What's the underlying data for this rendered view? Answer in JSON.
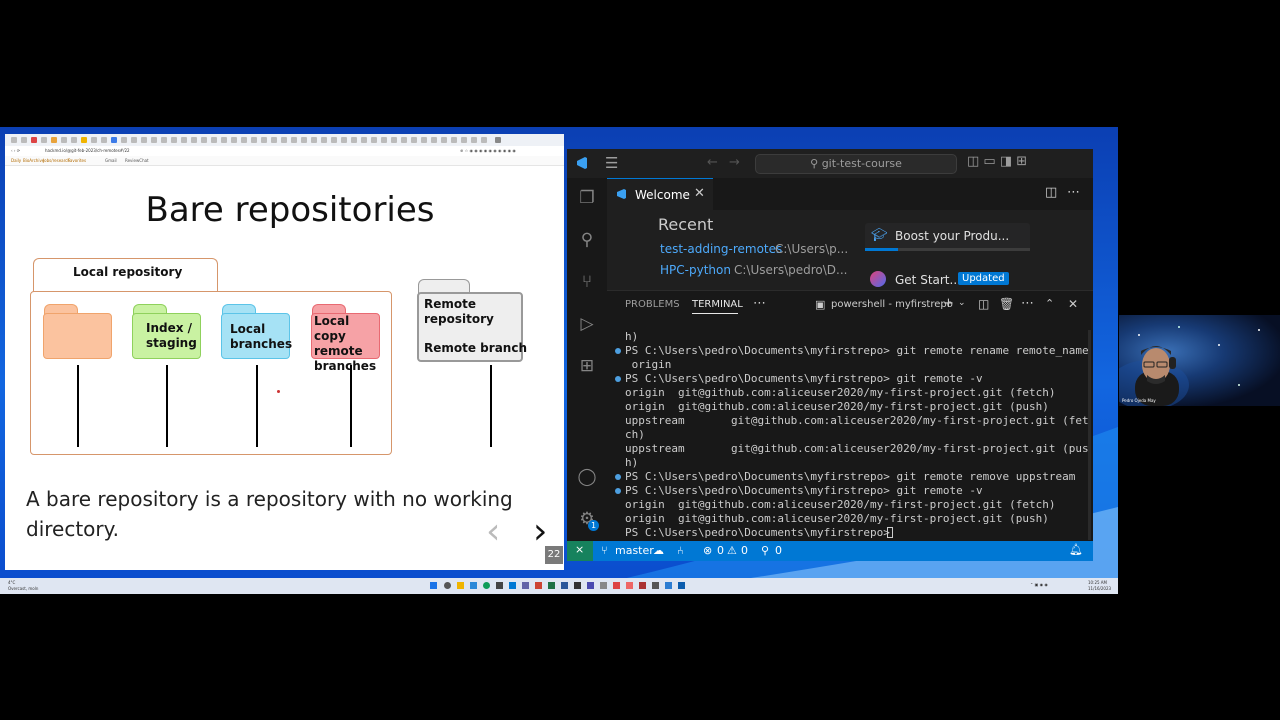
{
  "slide": {
    "title": "Bare repositories",
    "local_repo_label": "Local repository",
    "index_label": "Index / staging",
    "local_branches_label": "Local branches",
    "local_copy_label": "Local copy remote branches",
    "remote_repo_label": "Remote repository",
    "remote_branch_label": "Remote branch",
    "body_text": "A bare repository is a repository with no working directory.",
    "page_number": "22",
    "prev_arrow": "‹",
    "next_arrow": "›"
  },
  "browser": {
    "url_text": "hackmd.io/@git-feb-2023/ch-remotes#/22",
    "bookmarks": [
      "Daily",
      "BioArchive",
      "Jobs/research",
      "Favorites",
      "Gmail",
      "ReviewChat"
    ]
  },
  "vscode": {
    "search": "git-test-course",
    "tab_label": "Welcome",
    "recent_heading": "Recent",
    "recent": [
      {
        "name": "test-adding-remotes",
        "path": "C:\\Users\\p..."
      },
      {
        "name": "HPC-python",
        "path": "C:\\Users\\pedro\\D..."
      }
    ],
    "walkthroughs": [
      {
        "label": "Boost your Produ...",
        "badge": ""
      },
      {
        "label": "Get Start...",
        "badge": "Updated"
      }
    ],
    "panel_tabs": [
      "PROBLEMS",
      "TERMINAL"
    ],
    "terminal_name": "powershell - myfirstrepo",
    "terminal_lines": [
      "h)",
      "PS C:\\Users\\pedro\\Documents\\myfirstrepo> git remote rename remote_name",
      " origin",
      "PS C:\\Users\\pedro\\Documents\\myfirstrepo> git remote -v",
      "origin  git@github.com:aliceuser2020/my-first-project.git (fetch)",
      "origin  git@github.com:aliceuser2020/my-first-project.git (push)",
      "uppstream       git@github.com:aliceuser2020/my-first-project.git (fet",
      "ch)",
      "uppstream       git@github.com:aliceuser2020/my-first-project.git (pus",
      "h)",
      "PS C:\\Users\\pedro\\Documents\\myfirstrepo> git remote remove uppstream",
      "PS C:\\Users\\pedro\\Documents\\myfirstrepo> git remote -v",
      "origin  git@github.com:aliceuser2020/my-first-project.git (fetch)",
      "origin  git@github.com:aliceuser2020/my-first-project.git (push)",
      "PS C:\\Users\\pedro\\Documents\\myfirstrepo> "
    ],
    "status": {
      "branch": "master",
      "errors": "0",
      "warnings": "0",
      "ports": "0"
    },
    "settings_badge": "1"
  },
  "webcam": {
    "name_label": "Pedro Ojeda May"
  },
  "taskbar": {
    "weather": "4°C",
    "weather_sub": "Overcast, moln",
    "time": "10:25 AM",
    "date": "11/16/2023"
  },
  "colors": {
    "accent": "#0078d4",
    "link": "#4daafc",
    "folder_orange": "#fbc39f",
    "folder_green": "#c9f2a2",
    "folder_cyan": "#a6e2f5",
    "folder_red": "#f6a2a6",
    "folder_gray": "#eeeeee"
  }
}
